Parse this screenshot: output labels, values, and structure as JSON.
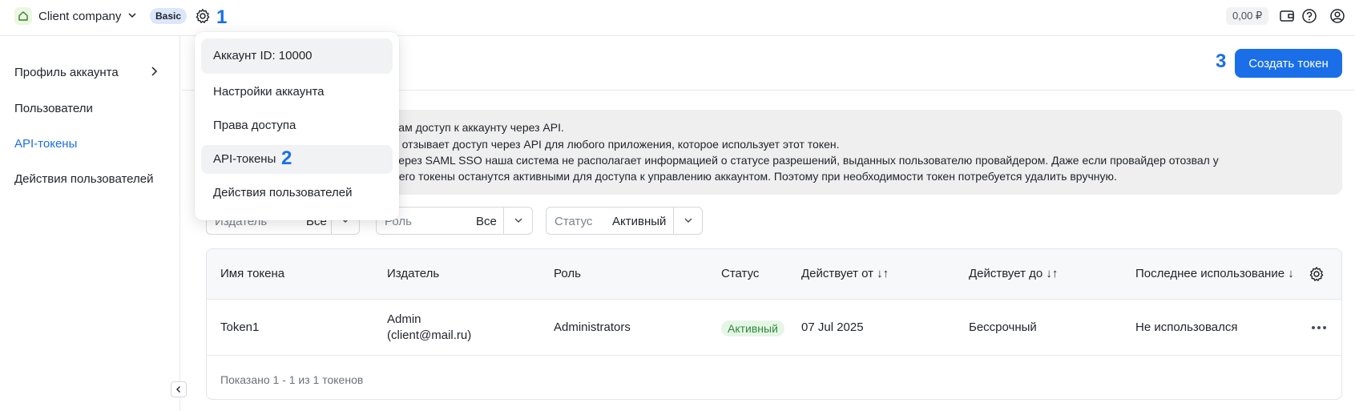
{
  "topbar": {
    "company_name": "Client company",
    "plan_badge": "Basic",
    "balance": "0,00 ₽",
    "step_1": "1"
  },
  "dropdown": {
    "account_id": "Аккаунт ID: 10000",
    "items": [
      "Настройки аккаунта",
      "Права доступа",
      "API-токены",
      "Действия пользователей"
    ],
    "step_2": "2"
  },
  "sidebar": {
    "items": [
      "Профиль аккаунта",
      "Пользователи",
      "API-токены",
      "Действия пользователей"
    ],
    "active": "API-токены"
  },
  "header": {
    "create_button": "Создать токен",
    "step_3": "3"
  },
  "info": {
    "lines": [
      "вам доступ к аккаунту через API.",
      "о отзывает доступ через API для любого приложения, которое использует этот токен.",
      "через SAML SSO наша система не располагает информацией о статусе разрешений, выданных пользователю провайдером. Даже если провайдер отозвал у",
      ", его токены останутся активными для доступа к управлению аккаунтом. Поэтому при необходимости токен потребуется удалить вручную."
    ]
  },
  "filters": {
    "issuer": {
      "placeholder": "Издатель",
      "value": "Все"
    },
    "role": {
      "placeholder": "Роль",
      "value": "Все"
    },
    "status": {
      "placeholder": "Статус",
      "value": "Активный"
    }
  },
  "table": {
    "columns": [
      "Имя токена",
      "Издатель",
      "Роль",
      "Статус",
      "Действует от ↓↑",
      "Действует до ↓↑",
      "Последнее использование ↓"
    ],
    "rows": [
      {
        "name": "Token1",
        "issuer_line1": "Admin",
        "issuer_line2": "(client@mail.ru)",
        "role": "Administrators",
        "status": "Активный",
        "valid_from": "07 Jul 2025",
        "valid_to": "Бессрочный",
        "last_used": "Не использовался"
      }
    ],
    "footer": "Показано 1 - 1 из 1 токенов"
  },
  "colors": {
    "accent": "#1a6fe8",
    "status_active_bg": "#e6f6e6",
    "status_active_fg": "#2e8b3a"
  }
}
